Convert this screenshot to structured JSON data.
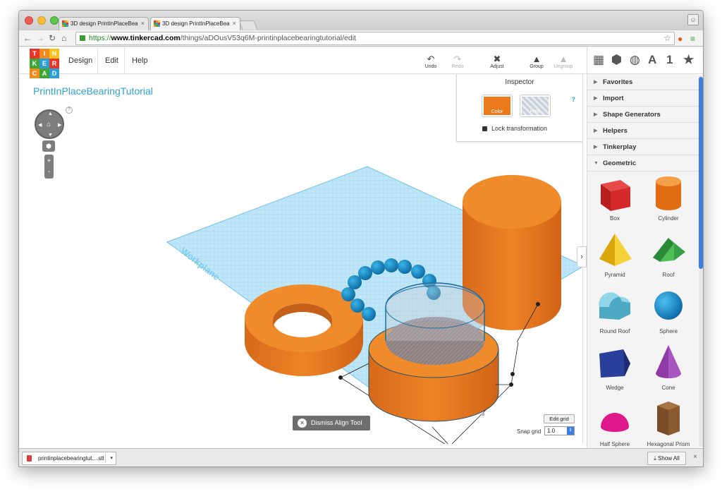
{
  "browser": {
    "tabs": [
      {
        "title": "3D design PrintInPlaceBea"
      },
      {
        "title": "3D design PrintInPlaceBea"
      }
    ],
    "tab_close": "×",
    "url_scheme": "https://",
    "url_host": "www.tinkercad.com",
    "url_path": "/things/aDOusV53q6M-printinplacebearingtutorial/edit"
  },
  "logo": {
    "letters": [
      "T",
      "I",
      "N",
      "K",
      "E",
      "R",
      "C",
      "A",
      "D"
    ],
    "colors": [
      "#e8352a",
      "#f28b1e",
      "#f6c21b",
      "#3fa535",
      "#2b9fd8",
      "#e8352a",
      "#f28b1e",
      "#3fa535",
      "#2b9fd8"
    ]
  },
  "menu": {
    "design": "Design",
    "edit": "Edit",
    "help": "Help"
  },
  "toolbar": {
    "undo": "Undo",
    "redo": "Redo",
    "adjust": "Adjust",
    "group": "Group",
    "ungroup": "Ungroup"
  },
  "panel_head": {
    "text_icon": "A",
    "number_icon": "1"
  },
  "design": {
    "title": "PrintInPlaceBearingTutorial"
  },
  "inspector": {
    "title": "Inspector",
    "help": "?",
    "color_label": "Color",
    "hole_label": "Hole",
    "lock_label": "Lock transformation",
    "color_hex": "#ec7a1b"
  },
  "view_controls": {
    "help": "?",
    "zoom_in": "+",
    "zoom_out": "-"
  },
  "workplane": {
    "label": "Workplane"
  },
  "dismiss": {
    "label": "Dismiss Align Tool",
    "icon": "×"
  },
  "grid": {
    "edit_label": "Edit grid",
    "snap_label": "Snap grid",
    "snap_value": "1.0"
  },
  "sidebar": {
    "categories": [
      {
        "label": "Favorites",
        "expanded": false
      },
      {
        "label": "Import",
        "expanded": false
      },
      {
        "label": "Shape Generators",
        "expanded": false
      },
      {
        "label": "Helpers",
        "expanded": false
      },
      {
        "label": "Tinkerplay",
        "expanded": false
      },
      {
        "label": "Geometric",
        "expanded": true
      }
    ],
    "shapes": [
      {
        "label": "Box",
        "color": "#d42a2a"
      },
      {
        "label": "Cylinder",
        "color": "#ec7a1b"
      },
      {
        "label": "Pyramid",
        "color": "#f3c218"
      },
      {
        "label": "Roof",
        "color": "#3aa545"
      },
      {
        "label": "Round Roof",
        "color": "#66bfd6"
      },
      {
        "label": "Sphere",
        "color": "#1f93d6"
      },
      {
        "label": "Wedge",
        "color": "#2a3f99"
      },
      {
        "label": "Cone",
        "color": "#8f3aa5"
      },
      {
        "label": "Half Sphere",
        "color": "#e0198a"
      },
      {
        "label": "Hexagonal Prism",
        "color": "#8a5a30"
      }
    ]
  },
  "downloads": {
    "file": "printinplacebearingtut....stl",
    "show_all": "Show All"
  }
}
